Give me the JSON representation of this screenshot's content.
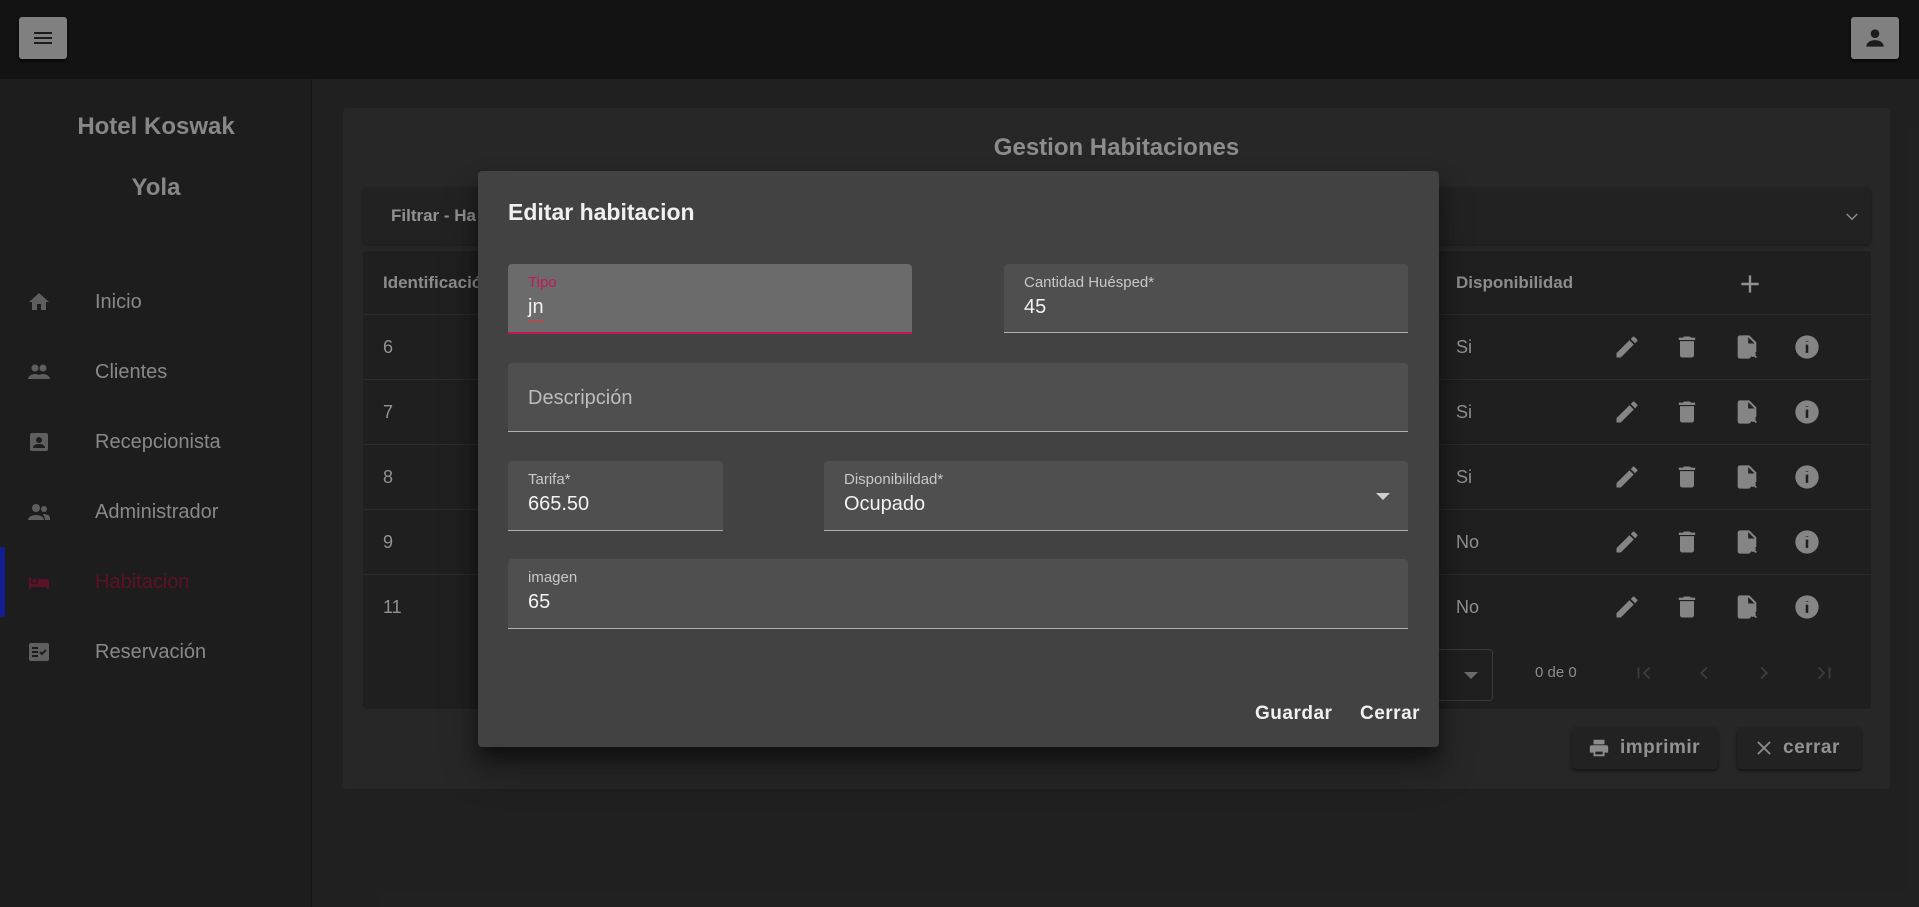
{
  "sidebar": {
    "brand_line1": "Hotel Koswak",
    "brand_line2": "Yola",
    "items": [
      {
        "label": "Inicio",
        "icon": "home-icon"
      },
      {
        "label": "Clientes",
        "icon": "people-icon"
      },
      {
        "label": "Recepcionista",
        "icon": "account-box-icon"
      },
      {
        "label": "Administrador",
        "icon": "supervisor-icon"
      },
      {
        "label": "Habitacion",
        "icon": "hotel-bed-icon",
        "active": true
      },
      {
        "label": "Reservación",
        "icon": "fact-check-icon"
      }
    ]
  },
  "main": {
    "title": "Gestion Habitaciones",
    "filter_label": "Filtrar - Ha",
    "table": {
      "headers": [
        "Identificació",
        "Disponibilidad"
      ],
      "rows": [
        {
          "id": "6",
          "disponibilidad": "Si"
        },
        {
          "id": "7",
          "disponibilidad": "Si"
        },
        {
          "id": "8",
          "disponibilidad": "Si"
        },
        {
          "id": "9",
          "disponibilidad": "No"
        },
        {
          "id": "11",
          "disponibilidad": "No"
        }
      ],
      "pager_range": "0 de 0"
    },
    "print_label": "imprimir",
    "close_label": "cerrar"
  },
  "dialog": {
    "title": "Editar habitacion",
    "tipo_label": "Tipo",
    "tipo_value": "jn",
    "cantidad_label": "Cantidad Huésped*",
    "cantidad_value": "45",
    "descripcion_placeholder": "Descripción",
    "tarifa_label": "Tarifa*",
    "tarifa_value": "665.50",
    "disponibilidad_label": "Disponibilidad*",
    "disponibilidad_value": "Ocupado",
    "imagen_label": "imagen",
    "imagen_value": "65",
    "save_label": "Guardar",
    "close_label": "Cerrar"
  },
  "colors": {
    "accent": "#c2185b",
    "active_nav_bar": "#1a2bd6"
  }
}
